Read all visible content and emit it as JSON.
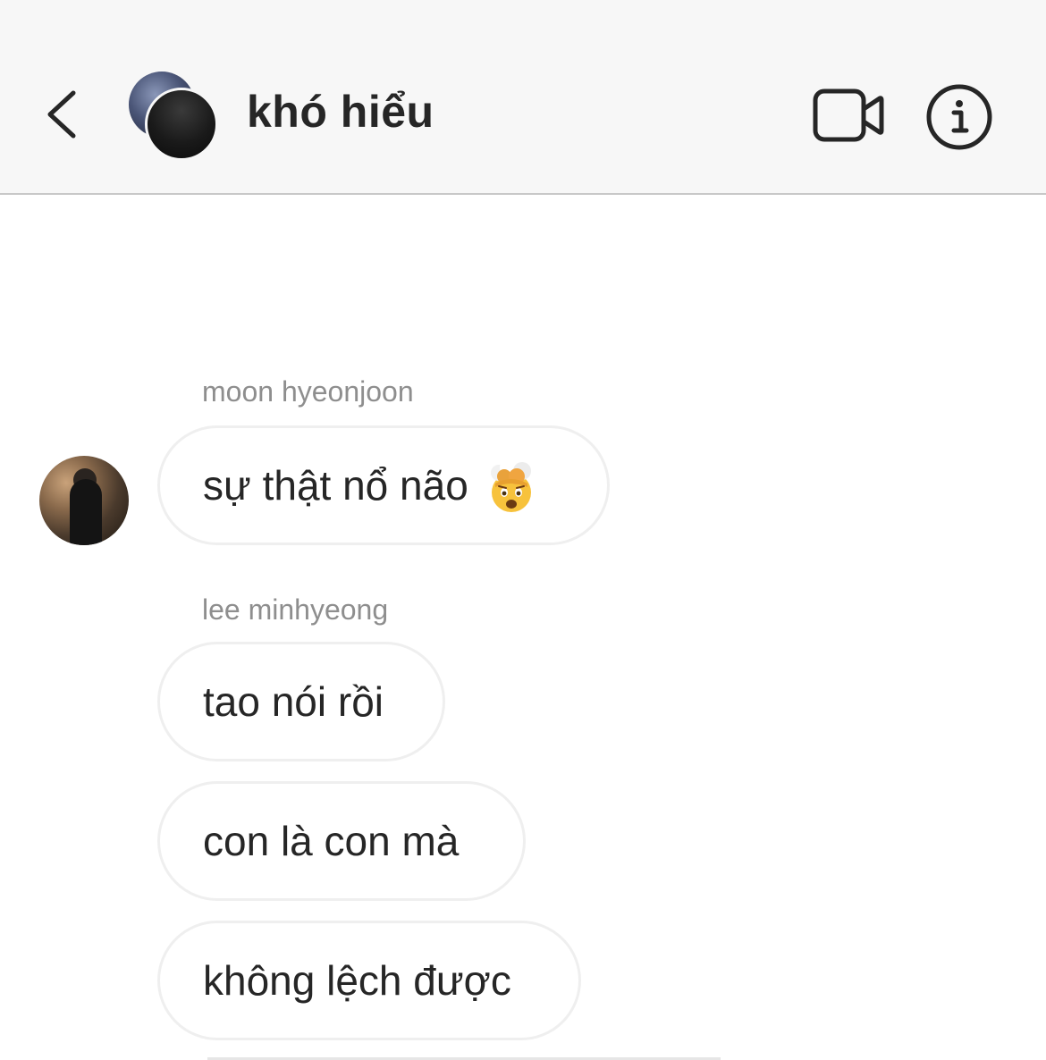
{
  "header": {
    "title": "khó hiểu",
    "back_icon": "chevron-left-icon",
    "video_icon": "video-call-icon",
    "info_icon": "info-icon"
  },
  "messages": [
    {
      "sender": "moon hyeonjoon",
      "text": "sự thật nổ não",
      "emoji": "exploding-head-emoji"
    },
    {
      "sender": "lee minhyeong",
      "texts": [
        "tao nói rồi",
        "con là con mà",
        "không lệch được"
      ]
    }
  ],
  "colors": {
    "header_bg": "#f7f7f7",
    "text": "#262626",
    "sender_text": "#8e8e8e",
    "bubble_border": "#efefef"
  }
}
